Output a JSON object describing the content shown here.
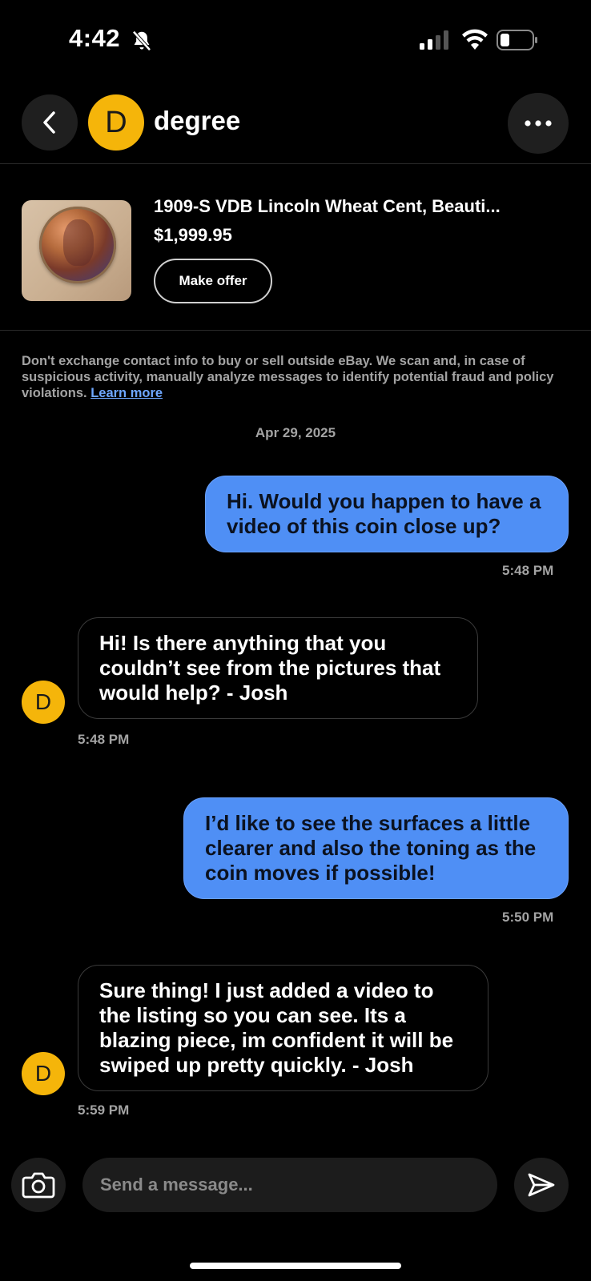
{
  "status_bar": {
    "time": "4:42"
  },
  "header": {
    "avatar_initial": "D",
    "username": "degree"
  },
  "listing": {
    "title": "1909-S VDB Lincoln Wheat Cent, Beauti...",
    "price": "$1,999.95",
    "offer_label": "Make offer"
  },
  "disclaimer": {
    "text": "Don't exchange contact info to buy or sell outside eBay. We scan and, in case of suspicious activity, manually analyze messages to identify potential fraud and policy violations. ",
    "link": "Learn more"
  },
  "date_divider": "Apr 29, 2025",
  "messages": [
    {
      "direction": "outgoing",
      "text": "Hi. Would you happen to have a video of this coin close up?",
      "time": "5:48 PM"
    },
    {
      "direction": "incoming",
      "avatar": "D",
      "text": "Hi! Is there anything that you couldn’t see from the pictures that would help? - Josh",
      "time": "5:48 PM"
    },
    {
      "direction": "outgoing",
      "text": "I’d like to see the surfaces a little clearer and also the toning as the coin moves if possible!",
      "time": "5:50 PM"
    },
    {
      "direction": "incoming",
      "avatar": "D",
      "text": "Sure thing! I just added a video to the listing so you can see. Its a blazing piece, im confident it will be swiped up pretty quickly. - Josh",
      "time": "5:59 PM"
    }
  ],
  "composer": {
    "placeholder": "Send a message..."
  },
  "colors": {
    "accent": "#4f8ff5",
    "avatar": "#f5b50a",
    "link": "#6ea7ff"
  }
}
